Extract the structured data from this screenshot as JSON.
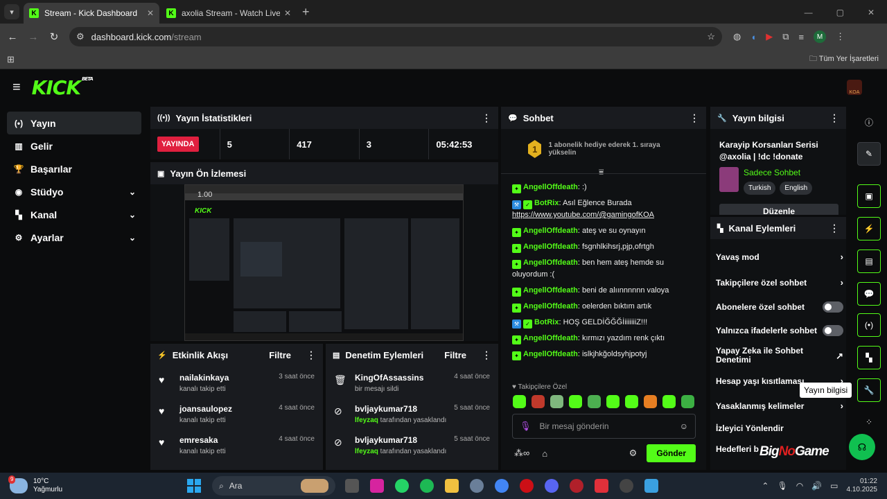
{
  "browser": {
    "tabs": [
      {
        "label": "Stream - Kick Dashboard",
        "active": true
      },
      {
        "label": "axolia Stream - Watch Live on K",
        "active": false
      }
    ],
    "url_host": "dashboard.kick.com",
    "url_path": "/stream",
    "bookmarks_label": "Tüm Yer İşaretleri",
    "profile_letter": "M"
  },
  "app": {
    "logo": "KICK",
    "beta": "BETA",
    "channel_badge": "KOA"
  },
  "sidebar": {
    "items": [
      {
        "label": "Yayın",
        "icon": "stream-icon",
        "active": true
      },
      {
        "label": "Gelir",
        "icon": "revenue-icon"
      },
      {
        "label": "Başarılar",
        "icon": "trophy-icon"
      },
      {
        "label": "Stüdyo",
        "icon": "studio-icon",
        "expandable": true
      },
      {
        "label": "Kanal",
        "icon": "channel-icon",
        "expandable": true
      },
      {
        "label": "Ayarlar",
        "icon": "gear-icon",
        "expandable": true
      }
    ]
  },
  "stats": {
    "title": "Yayın İstatistikleri",
    "status": "YAYINDA",
    "values": [
      "5",
      "417",
      "3",
      "05:42:53"
    ]
  },
  "preview": {
    "title": "Yayın Ön İzlemesi",
    "overlay_text": "1.00"
  },
  "activity": {
    "title": "Etkinlik Akışı",
    "filter": "Filtre",
    "items": [
      {
        "name": "nailakinkaya",
        "sub": "kanalı takip etti",
        "time": "3 saat önce"
      },
      {
        "name": "joansaulopez",
        "sub": "kanalı takip etti",
        "time": "4 saat önce"
      },
      {
        "name": "emresaka",
        "sub": "kanalı takip etti",
        "time": "4 saat önce"
      }
    ]
  },
  "moderation": {
    "title": "Denetim Eylemleri",
    "filter": "Filtre",
    "items": [
      {
        "name": "KingOfAssassins",
        "sub_pre": "",
        "sub": "bir mesajı sildi",
        "time": "4 saat önce",
        "icon": "trash-icon"
      },
      {
        "name": "bvljaykumar718",
        "sub_pre": "lfeyzaq",
        "sub": " tarafından yasaklandı",
        "time": "5 saat önce",
        "icon": "ban-icon"
      },
      {
        "name": "bvljaykumar718",
        "sub_pre": "lfeyzaq",
        "sub": " tarafından yasaklandı",
        "time": "5 saat önce",
        "icon": "ban-icon"
      }
    ]
  },
  "chat": {
    "title": "Sohbet",
    "banner_rank": "1",
    "banner_text": "1 abonelik hediye ederek 1. sıraya yükselin",
    "messages": [
      {
        "user": "AngellOffdeath",
        "bot": false,
        "text": ": :)"
      },
      {
        "user": "BotRix",
        "bot": true,
        "text": ": Asıl Eğlence Burada",
        "link": "https://www.youtube.com/@gamingofKOA"
      },
      {
        "user": "AngellOffdeath",
        "bot": false,
        "text": ": ateş ve su oynayın"
      },
      {
        "user": "AngellOffdeath",
        "bot": false,
        "text": ": fsgnhlkihsrj,pjp,ofrtgh"
      },
      {
        "user": "AngellOffdeath",
        "bot": false,
        "text": ": ben hem ateş hemde su oluyordum :("
      },
      {
        "user": "AngellOffdeath",
        "bot": false,
        "text": ": beni de alıınnnnnn valoya"
      },
      {
        "user": "AngellOffdeath",
        "bot": false,
        "text": ": oelerden bıktım artık"
      },
      {
        "user": "BotRix",
        "bot": true,
        "text": ": HOŞ GELDİĞĞĞİiiiiiiiZ!!!"
      },
      {
        "user": "AngellOffdeath",
        "bot": false,
        "text": ": kırmızı yazdım renk çıktı"
      },
      {
        "user": "AngellOffdeath",
        "bot": false,
        "text": ": islkjhkğoldsyhjpotyj"
      }
    ],
    "followers_only": "Takipçilere Özel",
    "input_placeholder": "Bir mesaj gönderin",
    "send": "Gönder",
    "emote_colors": [
      "#53fc18",
      "#c0392b",
      "#7fb77e",
      "#53fc18",
      "#4caf50",
      "#53fc18",
      "#53fc18",
      "#e67e22",
      "#53fc18",
      "#3cb043"
    ]
  },
  "info": {
    "title": "Yayın bilgisi",
    "stream_title": "Karayip Korsanları Serisi @axolia | !dc !donate",
    "category": "Sadece Sohbet",
    "tags": [
      "Turkish",
      "English"
    ],
    "edit": "Düzenle"
  },
  "channel_actions": {
    "title": "Kanal Eylemleri",
    "items": [
      {
        "label": "Yavaş mod",
        "control": "arrow"
      },
      {
        "label": "Takipçilere özel sohbet",
        "control": "arrow"
      },
      {
        "label": "Abonelere özel sohbet",
        "control": "toggle"
      },
      {
        "label": "Yalnızca ifadelerle sohbet",
        "control": "toggle"
      },
      {
        "label": "Yapay Zeka ile Sohbet Denetimi",
        "control": "external"
      },
      {
        "label": "Hesap yaşı kısıtlaması",
        "control": "arrow"
      },
      {
        "label": "Yasaklanmış kelimeler",
        "control": "arrow"
      },
      {
        "label": "İzleyici Yönlendir",
        "control": "none"
      },
      {
        "label": "Hedefleri b",
        "control": "arrow"
      }
    ]
  },
  "tooltip": "Yayın bilgisi",
  "watermark": {
    "a": "Big",
    "b": "No",
    "c": "Game"
  },
  "taskbar": {
    "temp": "10°C",
    "weather": "Yağmurlu",
    "weather_badge": "9",
    "search": "Ara",
    "time": "01:22",
    "date": "4.10.2025"
  }
}
